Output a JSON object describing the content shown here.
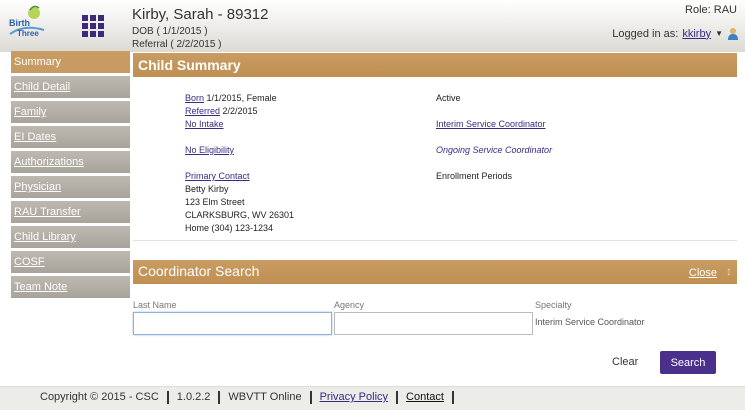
{
  "header": {
    "logo_text": "Birth to Three",
    "patient_name": "Kirby, Sarah - 89312",
    "dob": "DOB ( 1/1/2015 )",
    "referral": "Referral ( 2/2/2015 )",
    "role": "Role: RAU",
    "logged_in_prefix": "Logged in as:",
    "username": "kkirby"
  },
  "sidebar": {
    "items": [
      {
        "label": "Summary",
        "active": true
      },
      {
        "label": "Child Detail",
        "active": false
      },
      {
        "label": "Family",
        "active": false
      },
      {
        "label": "EI Dates",
        "active": false
      },
      {
        "label": "Authorizations",
        "active": false
      },
      {
        "label": "Physician",
        "active": false
      },
      {
        "label": "RAU Transfer",
        "active": false
      },
      {
        "label": "Child Library",
        "active": false
      },
      {
        "label": "COSF",
        "active": false
      },
      {
        "label": "Team Note",
        "active": false
      }
    ]
  },
  "child_summary": {
    "title": "Child Summary",
    "born_link": "Born",
    "born_text": "1/1/2015, Female",
    "referred_link": "Referred",
    "referred_text": "2/2/2015",
    "no_intake": "No Intake",
    "no_eligibility": "No Eligibility",
    "primary_contact": "Primary Contact",
    "contact_name": "Betty Kirby",
    "contact_street": "123 Elm Street",
    "contact_city": "CLARKSBURG, WV 26301",
    "contact_phone": "Home (304) 123-1234",
    "status": "Active",
    "interim_sc": "Interim Service Coordinator",
    "ongoing_sc": "Ongoing Service Coordinator",
    "enrollment_periods": "Enrollment Periods"
  },
  "coordinator_search": {
    "title": "Coordinator Search",
    "close_label": "Close",
    "last_name_label": "Last Name",
    "last_name_value": "",
    "agency_label": "Agency",
    "agency_value": "",
    "specialty_label": "Specialty",
    "specialty_value": "Interim Service Coordinator",
    "clear_label": "Clear",
    "search_label": "Search"
  },
  "footer": {
    "copyright": "Copyright © 2015 - CSC",
    "version": "1.0.2.2",
    "app_name": "WBVTT Online",
    "privacy": "Privacy Policy",
    "contact": "Contact"
  },
  "colors": {
    "brand_purple": "#4b2f8c",
    "panel_tan": "#c4965a",
    "nav_gray": "#b2ada5"
  }
}
